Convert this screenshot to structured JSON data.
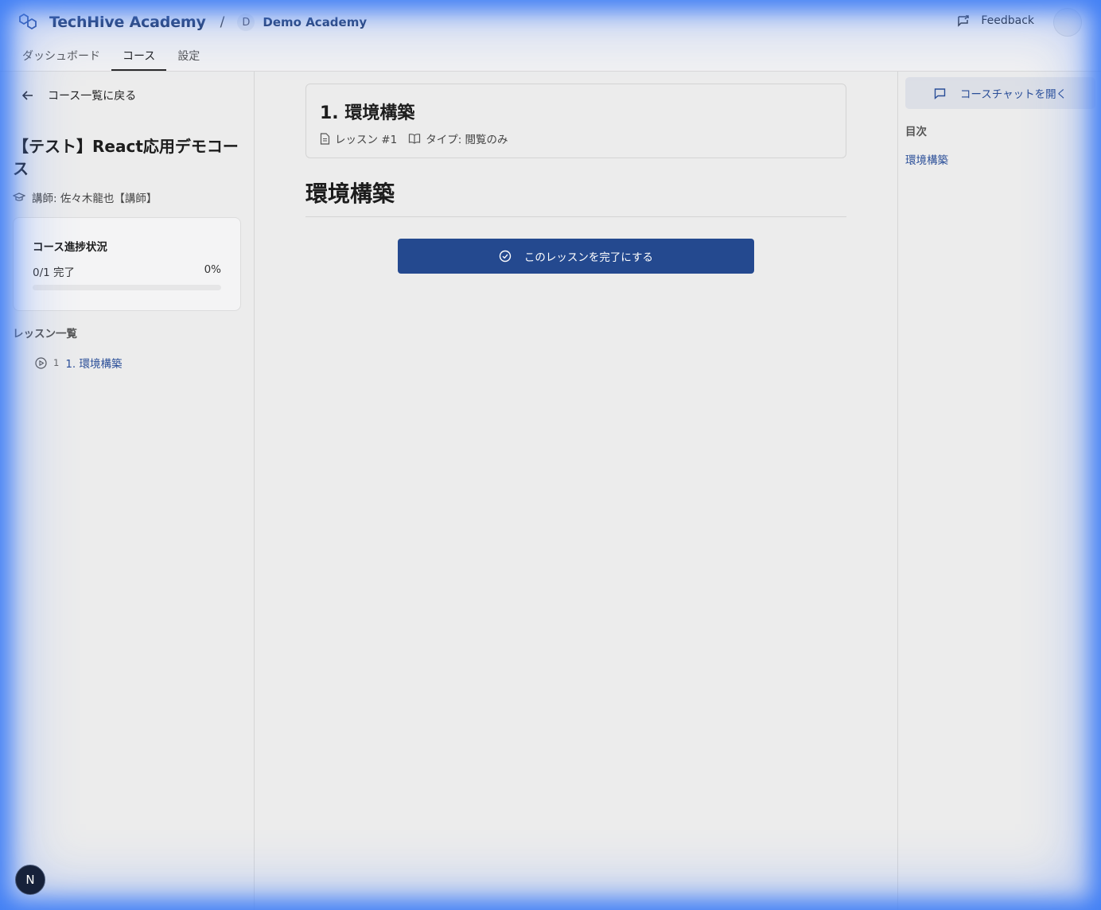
{
  "header": {
    "brand": "TechHive Academy",
    "separator": "/",
    "org_initial": "D",
    "org_name": "Demo Academy",
    "feedback_label": "Feedback",
    "brand_color": "#233a66"
  },
  "nav": {
    "tabs": [
      {
        "label": "ダッシュボード",
        "active": false
      },
      {
        "label": "コース",
        "active": true
      },
      {
        "label": "設定",
        "active": false
      }
    ]
  },
  "sidebar": {
    "back_label": "コース一覧に戻る",
    "course_title": "【テスト】React応用デモコース",
    "instructor": "講師: 佐々木龍也【講師】",
    "progress": {
      "title": "コース進捗状況",
      "count": "0/1 完了",
      "percent_label": "0%",
      "percent": 0
    },
    "lessons_heading": "レッスン一覧",
    "lessons": [
      {
        "num": "1",
        "name": "1. 環境構築"
      }
    ],
    "dev_badge": "N"
  },
  "main": {
    "lesson_title": "1. 環境構築",
    "lesson_number": "レッスン #1",
    "lesson_type": "タイプ: 閲覧のみ",
    "content_heading": "環境構築",
    "complete_button": "このレッスンを完了にする",
    "accent_color": "#24498f"
  },
  "right": {
    "chat_button": "コースチャットを開く",
    "toc_heading": "目次",
    "toc_items": [
      "環境構築"
    ]
  }
}
